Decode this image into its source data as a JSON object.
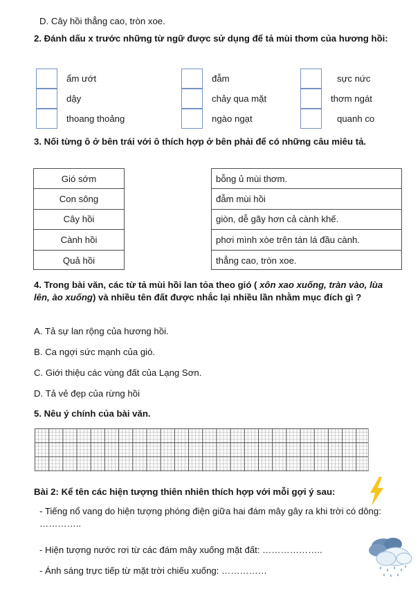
{
  "intro": {
    "option_d": "D. Cây hồi thẳng cao, tròn xoe."
  },
  "question2": {
    "heading": "2. Đánh dấu x trước những từ ngữ được sử dụng để tả mùi thơm của hương hồi:",
    "columns": [
      {
        "items": [
          "ẩm ướt",
          "dậy",
          "thoang thoảng"
        ]
      },
      {
        "items": [
          "đẫm",
          "chảy qua mặt",
          "ngào ngạt"
        ]
      },
      {
        "items": [
          "sực nức",
          "thơm ngát",
          "quanh co"
        ]
      }
    ]
  },
  "question3": {
    "heading": "3. Nối từng ô ở bên trái với ô thích hợp ở bên phải để có những câu miêu tả.",
    "left_items": [
      "Gió sớm",
      "Con sông",
      "Cây hồi",
      "Cành hồi",
      "Quả hồi"
    ],
    "right_items": [
      "bỗng ủ mùi thơm.",
      "đẫm mùi hồi",
      "giòn, dễ gãy hơn cả cành khế.",
      "phơi mình xòe trên tán lá đầu cành.",
      "thẳng cao, tròn xoe."
    ]
  },
  "question4": {
    "heading_part1": "4. Trong bài văn, các từ tả mùi hồi lan tỏa theo gió ( ",
    "heading_italic": "xôn xao xuống, tràn vào, lùa lên, ào xuống",
    "heading_part2": ") và nhiều tên đất được nhắc lại nhiều lần nhằm mục đích gì ?",
    "options": [
      "A. Tả sự lan rộng của hương hồi.",
      "B. Ca ngợi sức mạnh của gió.",
      "C. Giới thiệu các vùng đất của Lạng Sơn.",
      "D. Tả vẻ đẹp của rừng hồi"
    ]
  },
  "question5": {
    "heading": "5. Nêu ý chính của bài văn."
  },
  "bai2": {
    "heading": "Bài 2: Kể tên các hiện tượng thiên nhiên thích hợp với mỗi gợi ý sau:",
    "items": [
      "- Tiếng nổ  vang do hiện tượng phóng điện giữa hai đám mây gây ra khi trời có dông: …………..",
      "- Hiện tượng nước rơi từ các đám mây xuống mặt đất: ………………..",
      "- Ánh sáng trực tiếp từ mặt trời chiếu xuống: ……………"
    ]
  },
  "decorations": {
    "lightning_color": "#F7C51E",
    "cloud_dark_color": "#6E8FB5",
    "cloud_light_color": "#E8F1F8",
    "raindrop_color": "#8FAFC9"
  },
  "styles": {
    "checkbox_border_color": "#7691c4",
    "table_border_color": "#4d4d4d"
  }
}
